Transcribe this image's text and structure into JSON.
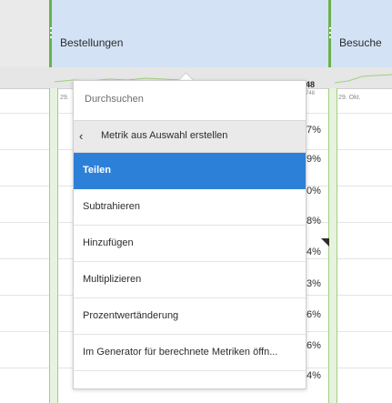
{
  "columns": [
    {
      "title": "Bestellungen"
    },
    {
      "title": "Besuche"
    }
  ],
  "sparkline": {
    "value_primary": "48",
    "value_sub": "748",
    "date_left": "29.",
    "date_right": "29. Okt."
  },
  "percentages": [
    "7%",
    "9%",
    "0%",
    "8%",
    "4%",
    "3%",
    "6%",
    "6%",
    "4%"
  ],
  "menu": {
    "search_placeholder": "Durchsuchen",
    "back_label": "Metrik aus Auswahl erstellen",
    "items": [
      {
        "label": "Teilen",
        "selected": true
      },
      {
        "label": "Subtrahieren",
        "selected": false
      },
      {
        "label": "Hinzufügen",
        "selected": false
      },
      {
        "label": "Multiplizieren",
        "selected": false
      },
      {
        "label": "Prozentwertänderung",
        "selected": false
      },
      {
        "label": "Im Generator für berechnete Metriken öffn...",
        "selected": false
      }
    ]
  },
  "colors": {
    "header_blue": "#d3e3f5",
    "accent_green": "#6ab04c",
    "selection_blue": "#2d80d8"
  }
}
